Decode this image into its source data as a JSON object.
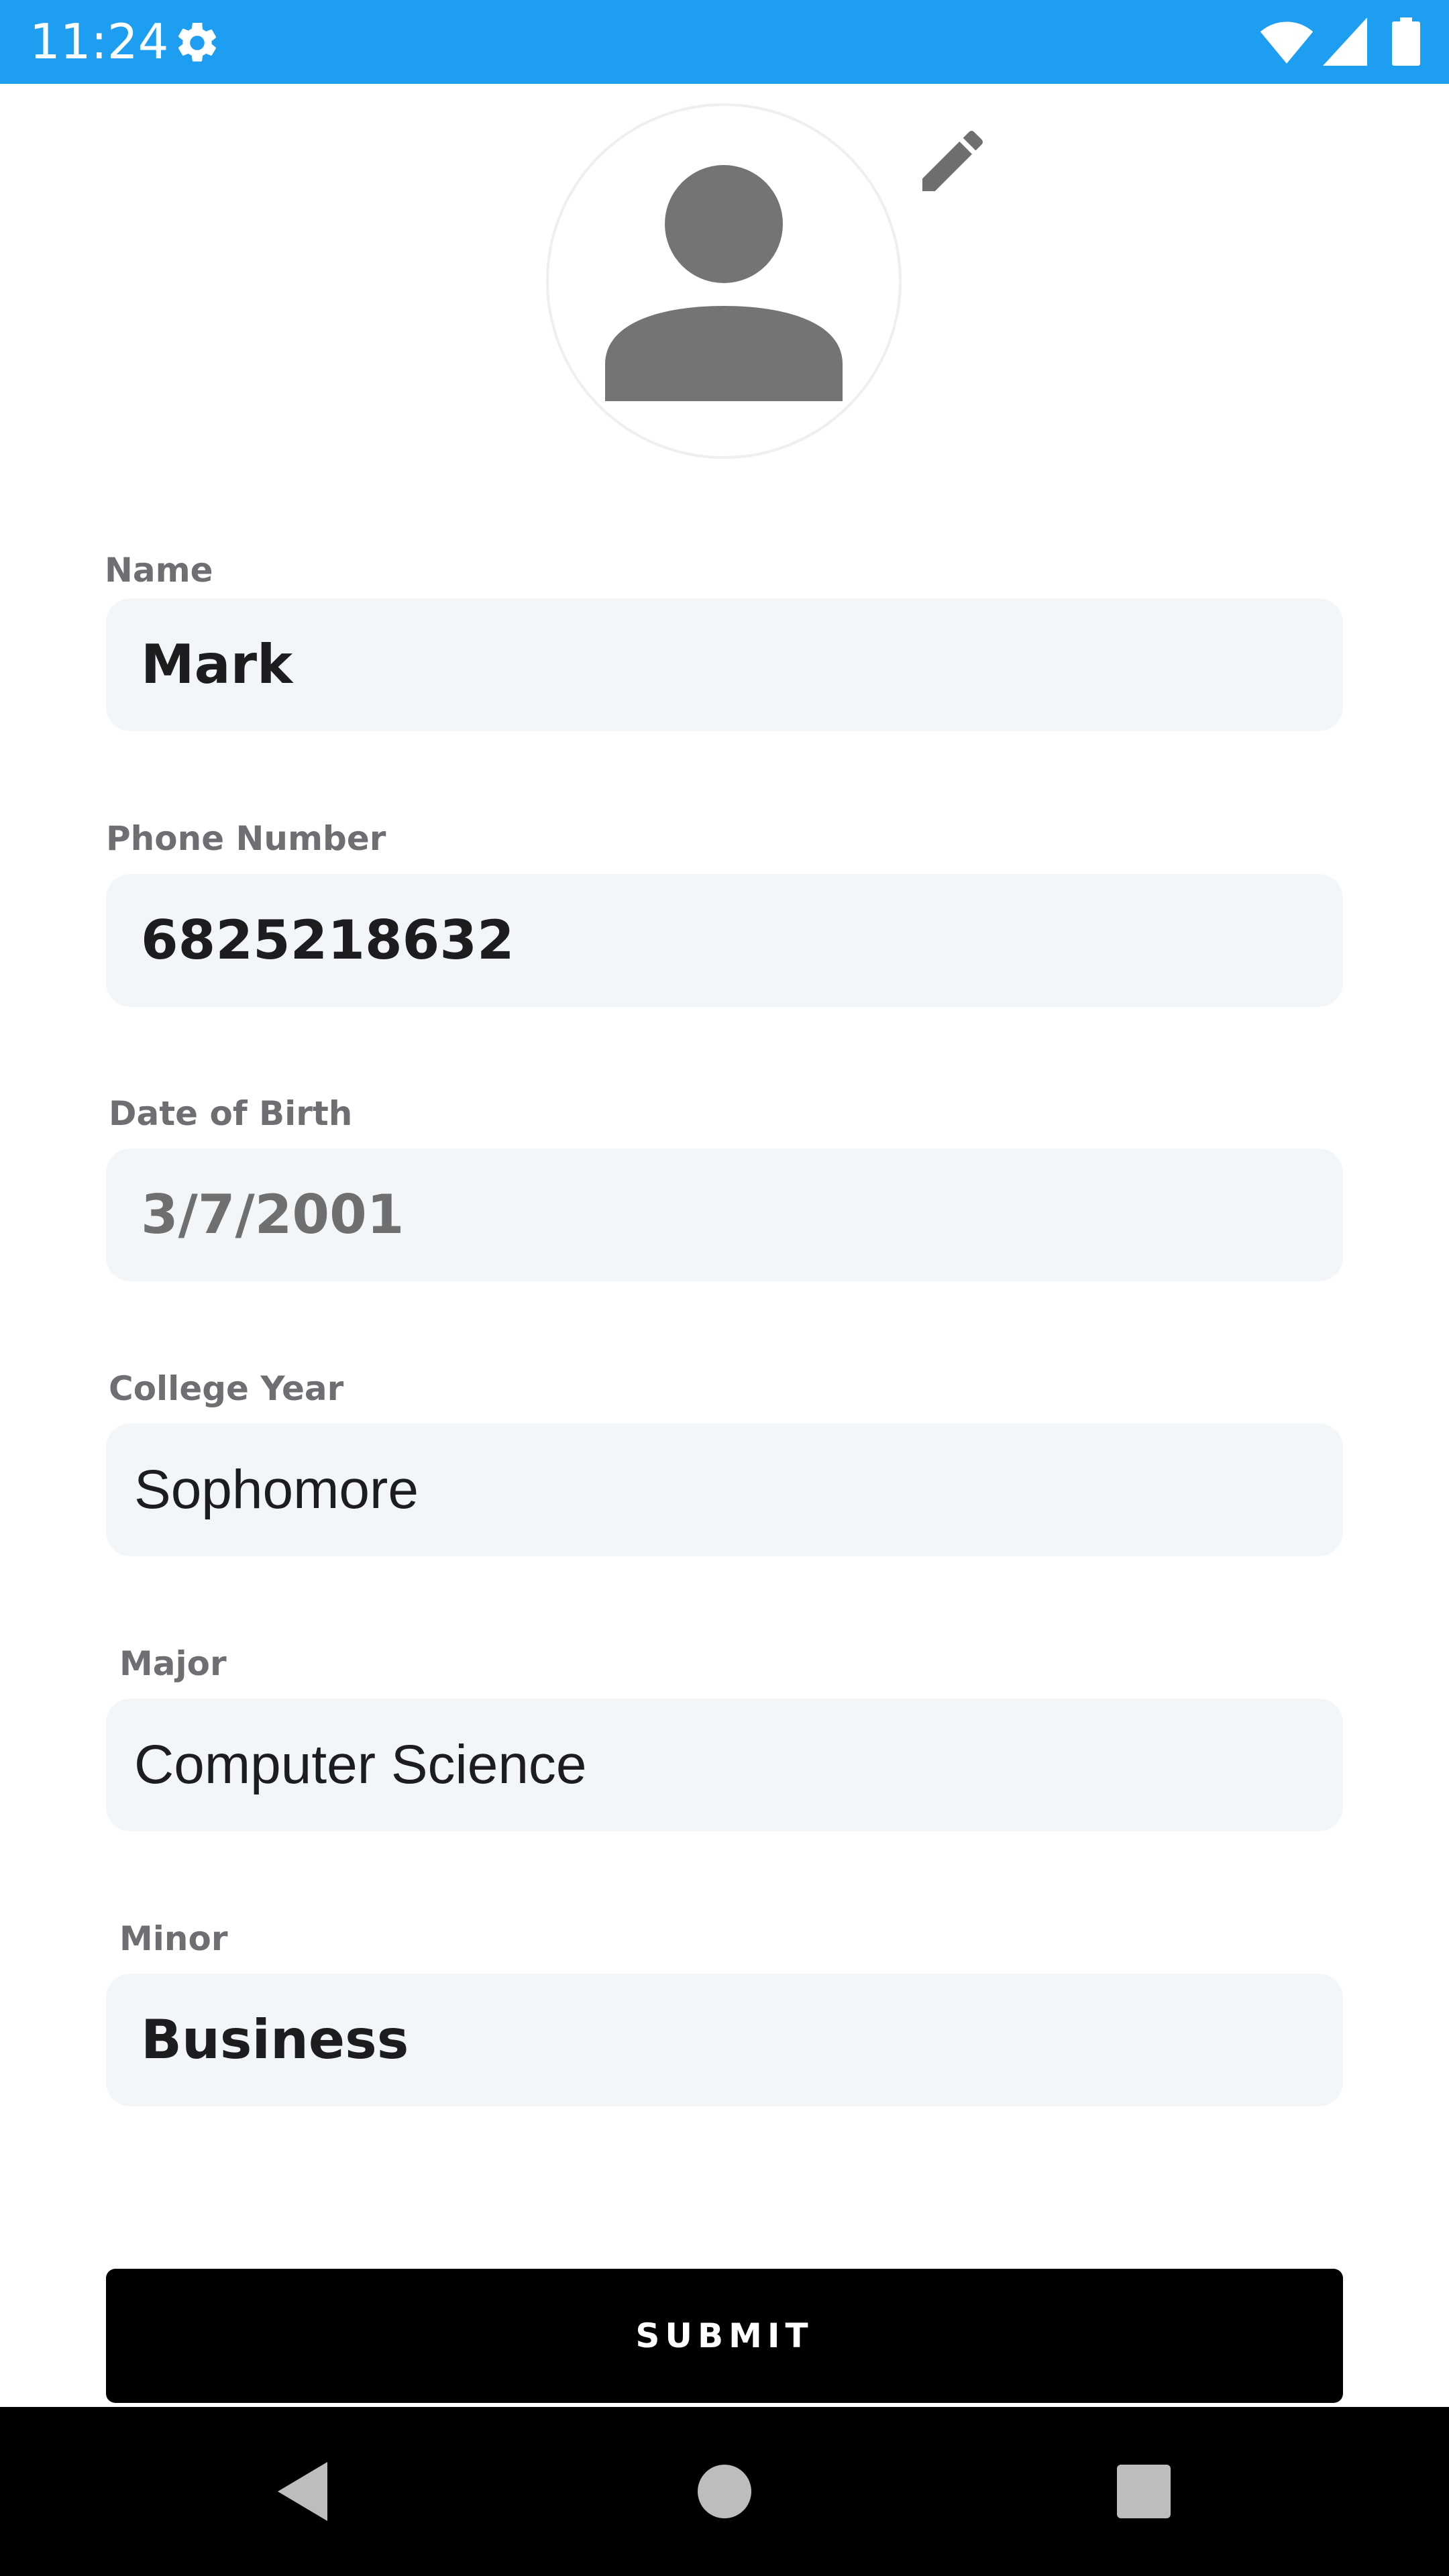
{
  "status_bar": {
    "time": "11:24",
    "settings_icon": "gear-icon",
    "wifi_icon": "wifi-icon",
    "signal_icon": "cell-signal-icon",
    "battery_icon": "battery-icon",
    "background": "#1e9ef0"
  },
  "profile": {
    "avatar_icon": "person-icon",
    "edit_icon": "pencil-icon"
  },
  "form": {
    "name": {
      "label": "Name",
      "value": "Mark"
    },
    "phone": {
      "label": "Phone Number",
      "value": "6825218632"
    },
    "dob": {
      "label": "Date of Birth",
      "value": "3/7/2001"
    },
    "college_year": {
      "label": "College Year",
      "value": "Sophomore"
    },
    "major": {
      "label": "Major",
      "value": "Computer Science"
    },
    "minor": {
      "label": "Minor",
      "value": "Business"
    },
    "submit_label": "SUBMIT"
  },
  "nav_bar": {
    "back_icon": "back-triangle-icon",
    "home_icon": "home-circle-icon",
    "recents_icon": "recents-square-icon"
  }
}
